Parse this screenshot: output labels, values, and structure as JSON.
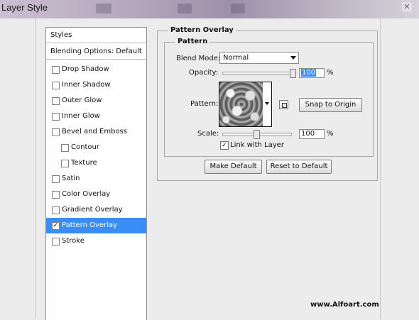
{
  "window": {
    "title": "Layer Style",
    "close_glyph": "✕"
  },
  "styles_panel": {
    "header": "Styles",
    "blending_options": "Blending Options: Default",
    "items": [
      {
        "label": "Drop Shadow",
        "checked": false,
        "indent": false,
        "selected": false
      },
      {
        "label": "Inner Shadow",
        "checked": false,
        "indent": false,
        "selected": false
      },
      {
        "label": "Outer Glow",
        "checked": false,
        "indent": false,
        "selected": false
      },
      {
        "label": "Inner Glow",
        "checked": false,
        "indent": false,
        "selected": false
      },
      {
        "label": "Bevel and Emboss",
        "checked": false,
        "indent": false,
        "selected": false
      },
      {
        "label": "Contour",
        "checked": false,
        "indent": true,
        "selected": false
      },
      {
        "label": "Texture",
        "checked": false,
        "indent": true,
        "selected": false
      },
      {
        "label": "Satin",
        "checked": false,
        "indent": false,
        "selected": false
      },
      {
        "label": "Color Overlay",
        "checked": false,
        "indent": false,
        "selected": false
      },
      {
        "label": "Gradient Overlay",
        "checked": false,
        "indent": false,
        "selected": false
      },
      {
        "label": "Pattern Overlay",
        "checked": true,
        "indent": false,
        "selected": true
      },
      {
        "label": "Stroke",
        "checked": false,
        "indent": false,
        "selected": false
      }
    ]
  },
  "pattern_overlay": {
    "section_title": "Pattern Overlay",
    "group_title": "Pattern",
    "blend_mode_label": "Blend Mode:",
    "blend_mode_value": "Normal",
    "opacity_label": "Opacity:",
    "opacity_value": "100",
    "opacity_level": 1.0,
    "pattern_label": "Pattern:",
    "snap_button": "Snap to Origin",
    "scale_label": "Scale:",
    "scale_value": "100",
    "scale_level": 0.5,
    "percent": "%",
    "link_label": "Link with Layer",
    "link_checked": true,
    "make_default": "Make Default",
    "reset_default": "Reset to Default"
  },
  "watermark": "www.Alfoart.com",
  "colors": {
    "selection": "#3a8df2",
    "check": "✓"
  }
}
